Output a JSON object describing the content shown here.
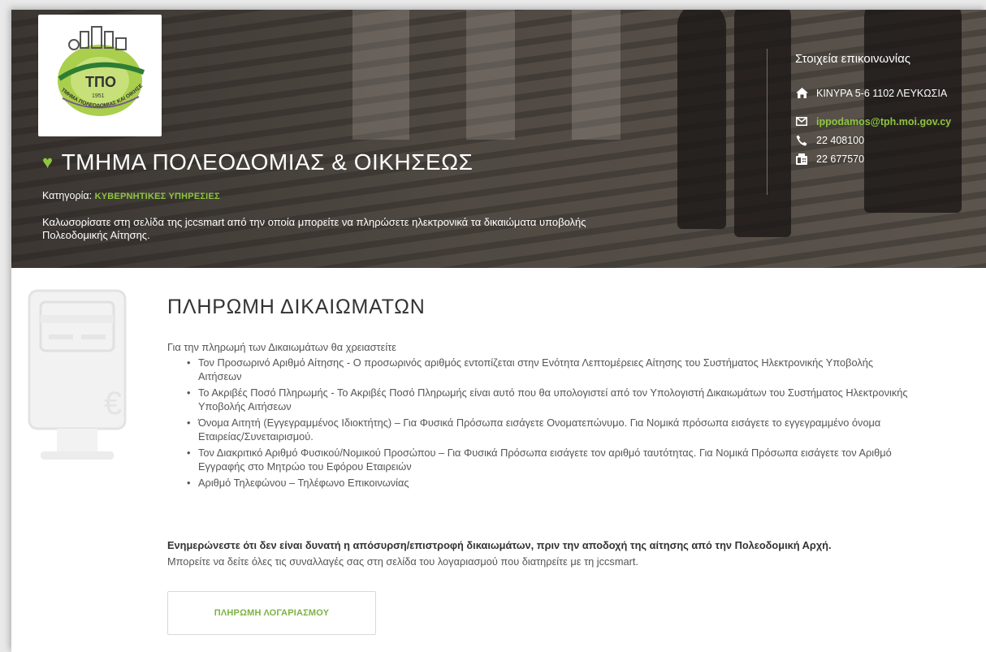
{
  "org": {
    "logo_text": "ΤΠΟ",
    "logo_year": "1951",
    "logo_ring_text": "ΤΜΗΜΑ ΠΟΛΕΟΔΟΜΙΑΣ ΚΑΙ ΟΙΚΗΣΕΩΣ",
    "title": "ΤΜΗΜΑ ΠΟΛΕΟΔΟΜΙΑΣ & ΟΙΚΗΣΕΩΣ",
    "category_label": "Κατηγορία: ",
    "category_value": "ΚΥΒΕΡΝΗΤΙΚΕΣ ΥΠΗΡΕΣΙΕΣ",
    "welcome": "Καλωσορίσατε στη σελίδα της jccsmart από την οποία μπορείτε να πληρώσετε ηλεκτρονικά τα δικαιώματα υποβολής Πολεοδομικής Αίτησης."
  },
  "contact": {
    "title": "Στοιχεία επικοινωνίας",
    "address": "ΚΙΝΥΡΑ 5-6 1102 ΛΕΥΚΩΣΙΑ",
    "email": "ippodamos@tph.moi.gov.cy",
    "phone": "22 408100",
    "fax": "22 677570"
  },
  "payment": {
    "title": "ΠΛΗΡΩΜΗ ΔΙΚΑΙΩΜΑΤΩΝ",
    "intro": "Για την πληρωμή των Δικαιωμάτων θα χρειαστείτε",
    "requirements": [
      "Τον Προσωρινό Αριθμό Αίτησης - Ο προσωρινός αριθμός εντοπίζεται στην Ενότητα Λεπτομέρειες Αίτησης του Συστήματος Ηλεκτρονικής Υποβολής Αιτήσεων",
      "Το Ακριβές Ποσό Πληρωμής - Το Ακριβές Ποσό Πληρωμής είναι αυτό που θα υπολογιστεί από τον Υπολογιστή Δικαιωμάτων του Συστήματος Ηλεκτρονικής Υποβολής Αιτήσεων",
      "Όνομα Αιτητή (Εγγεγραμμένος Ιδιοκτήτης) – Για Φυσικά Πρόσωπα εισάγετε Ονοματεπώνυμο. Για Νομικά πρόσωπα εισάγετε το εγγεγραμμένο όνομα Εταιρείας/Συνεταιρισμού.",
      "Τον Διακριτικό Αριθμό Φυσικού/Νομικού Προσώπου – Για Φυσικά Πρόσωπα εισάγετε τον αριθμό ταυτότητας. Για Νομικά Πρόσωπα εισάγετε τον Αριθμό Εγγραφής στο Μητρώο του Εφόρου Εταιρειών",
      "Αριθμό Τηλεφώνου – Τηλέφωνο Επικοινωνίας"
    ],
    "warning": "Ενημερώνεστε ότι δεν είναι δυνατή η απόσυρση/επιστροφή δικαιωμάτων, πριν την αποδοχή της αίτησης από την Πολεοδομική Αρχή.",
    "note": "Μπορείτε να δείτε όλες τις συναλλαγές σας στη σελίδα του λογαριασμού που διατηρείτε με τη jccsmart.",
    "button_label": "ΠΛΗΡΩΜΗ ΛΟΓΑΡΙΑΣΜΟΥ"
  },
  "colors": {
    "accent_green": "#8dc63f",
    "button_text_green": "#7cb342"
  },
  "icons": [
    "heart-icon",
    "home-icon",
    "envelope-icon",
    "phone-icon",
    "fax-icon",
    "payment-terminal-icon"
  ]
}
